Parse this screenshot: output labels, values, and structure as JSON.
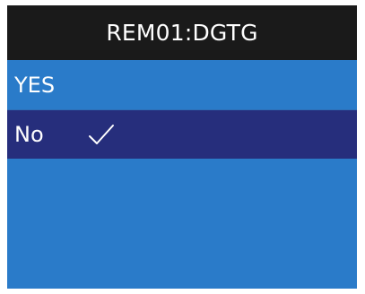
{
  "screen": {
    "title": "REM01:DGTG",
    "options": [
      {
        "label": "YES",
        "selected": false
      },
      {
        "label": "No",
        "selected": true
      }
    ],
    "selected_indicator_icon": "checkmark-icon"
  },
  "colors": {
    "title_background": "#1a1a1a",
    "list_background": "#2a7bc9",
    "selected_background": "#262e7c",
    "text": "#ffffff"
  }
}
